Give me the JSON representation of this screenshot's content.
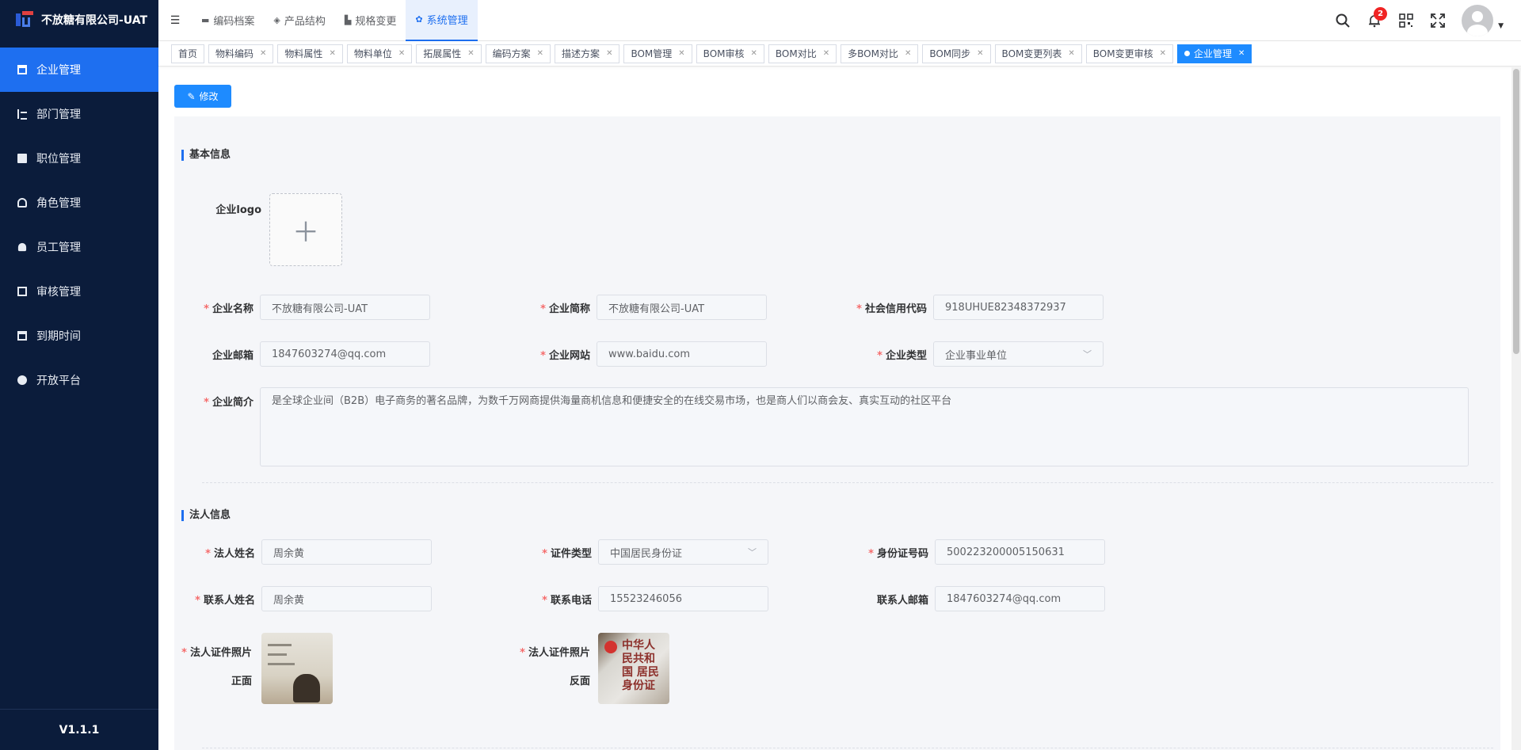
{
  "sidebar": {
    "brand": "不放糖有限公司-UAT",
    "items": [
      {
        "label": "企业管理",
        "active": true,
        "icon": "building-icon"
      },
      {
        "label": "部门管理",
        "active": false,
        "icon": "tree-icon"
      },
      {
        "label": "职位管理",
        "active": false,
        "icon": "id-card-icon"
      },
      {
        "label": "角色管理",
        "active": false,
        "icon": "car-icon"
      },
      {
        "label": "员工管理",
        "active": false,
        "icon": "user-icon"
      },
      {
        "label": "审核管理",
        "active": false,
        "icon": "check-square-icon"
      },
      {
        "label": "到期时间",
        "active": false,
        "icon": "calendar-icon"
      },
      {
        "label": "开放平台",
        "active": false,
        "icon": "open-platform-icon"
      }
    ],
    "version": "V1.1.1"
  },
  "header": {
    "tabs": [
      {
        "label": "编码档案",
        "icon": "folder-icon"
      },
      {
        "label": "产品结构",
        "icon": "layers-icon"
      },
      {
        "label": "规格变更",
        "icon": "chart-icon"
      },
      {
        "label": "系统管理",
        "icon": "gear-icon",
        "active": true
      }
    ],
    "notification_count": "2"
  },
  "tags": [
    {
      "label": "首页",
      "closable": false
    },
    {
      "label": "物料编码",
      "closable": true
    },
    {
      "label": "物料属性",
      "closable": true
    },
    {
      "label": "物料单位",
      "closable": true
    },
    {
      "label": "拓展属性",
      "closable": true
    },
    {
      "label": "编码方案",
      "closable": true
    },
    {
      "label": "描述方案",
      "closable": true
    },
    {
      "label": "BOM管理",
      "closable": true
    },
    {
      "label": "BOM审核",
      "closable": true
    },
    {
      "label": "BOM对比",
      "closable": true
    },
    {
      "label": "多BOM对比",
      "closable": true
    },
    {
      "label": "BOM同步",
      "closable": true
    },
    {
      "label": "BOM变更列表",
      "closable": true
    },
    {
      "label": "BOM变更审核",
      "closable": true
    },
    {
      "label": "企业管理",
      "closable": true,
      "active": true
    }
  ],
  "toolbar": {
    "edit_label": "修改"
  },
  "basic": {
    "title": "基本信息",
    "logo_label": "企业logo",
    "name_label": "企业名称",
    "name_value": "不放糖有限公司-UAT",
    "short_label": "企业简称",
    "short_value": "不放糖有限公司-UAT",
    "credit_label": "社会信用代码",
    "credit_value": "918UHUE82348372937",
    "email_label": "企业邮箱",
    "email_value": "1847603274@qq.com",
    "site_label": "企业网站",
    "site_value": "www.baidu.com",
    "type_label": "企业类型",
    "type_value": "企业事业单位",
    "intro_label": "企业简介",
    "intro_value": "是全球企业间（B2B）电子商务的著名品牌，为数千万网商提供海量商机信息和便捷安全的在线交易市场，也是商人们以商会友、真实互动的社区平台"
  },
  "legal": {
    "title": "法人信息",
    "name_label": "法人姓名",
    "name_value": "周余黄",
    "idtype_label": "证件类型",
    "idtype_value": "中国居民身份证",
    "idno_label": "身份证号码",
    "idno_value": "500223200005150631",
    "contact_label": "联系人姓名",
    "contact_value": "周余黄",
    "phone_label": "联系电话",
    "phone_value": "15523246056",
    "cemail_label": "联系人邮箱",
    "cemail_value": "1847603274@qq.com",
    "front_label_1": "法人证件照片",
    "front_label_2": "正面",
    "back_label_1": "法人证件照片",
    "back_label_2": "反面",
    "back_card_text": "中华人民共和国 居民身份证"
  },
  "colors": {
    "primary": "#1e6ff0",
    "sidebar": "#0b1c3b",
    "required": "#f56c6c"
  }
}
